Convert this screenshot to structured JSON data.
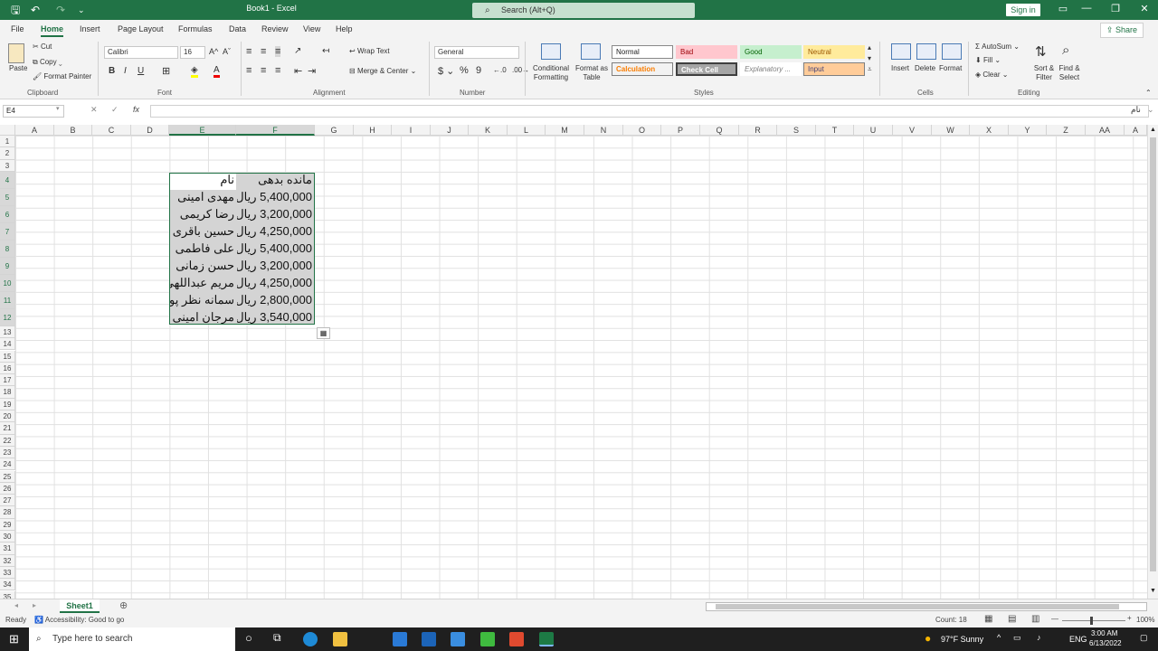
{
  "window": {
    "title": "Book1  -  Excel",
    "search": "Search (Alt+Q)",
    "signin": "Sign in"
  },
  "menu": {
    "items": [
      "File",
      "Home",
      "Insert",
      "Page Layout",
      "Formulas",
      "Data",
      "Review",
      "View",
      "Help"
    ],
    "share": "Share"
  },
  "ribbon": {
    "clipboard": {
      "paste": "Paste",
      "cut": "Cut",
      "copy": "Copy",
      "format_painter": "Format Painter",
      "label": "Clipboard"
    },
    "font": {
      "name": "Calibri",
      "size": "16",
      "label": "Font"
    },
    "alignment": {
      "wrap": "Wrap Text",
      "merge": "Merge & Center",
      "label": "Alignment"
    },
    "number": {
      "format": "General",
      "label": "Number"
    },
    "styles": {
      "conditional": "Conditional Formatting",
      "format_table": "Format as Table",
      "normal": "Normal",
      "bad": "Bad",
      "good": "Good",
      "neutral": "Neutral",
      "calculation": "Calculation",
      "check_cell": "Check Cell",
      "explanatory": "Explanatory ...",
      "input": "Input",
      "label": "Styles"
    },
    "cells": {
      "insert": "Insert",
      "delete": "Delete",
      "format": "Format",
      "label": "Cells"
    },
    "editing": {
      "autosum": "AutoSum",
      "fill": "Fill",
      "clear": "Clear",
      "sort": "Sort & Filter",
      "find": "Find & Select",
      "label": "Editing"
    }
  },
  "formula_bar": {
    "name_box": "E4",
    "fx": "fx",
    "right_label": "نام"
  },
  "columns": [
    "A",
    "B",
    "C",
    "D",
    "E",
    "F",
    "G",
    "H",
    "I",
    "J",
    "K",
    "L",
    "M",
    "N",
    "O",
    "P",
    "Q",
    "R",
    "S",
    "T",
    "U",
    "V",
    "W",
    "X",
    "Y",
    "Z",
    "AA",
    "A"
  ],
  "rows": [
    "1",
    "2",
    "3",
    "4",
    "5",
    "6",
    "7",
    "8",
    "9",
    "10",
    "11",
    "12",
    "13",
    "14",
    "15",
    "16",
    "17",
    "18",
    "19",
    "20",
    "21",
    "22",
    "23",
    "24",
    "25",
    "26",
    "27",
    "28",
    "29",
    "30",
    "31",
    "32",
    "33",
    "34",
    "35"
  ],
  "table": {
    "headers": {
      "name": "نام",
      "balance": "مانده بدهی"
    },
    "rows": [
      {
        "name": "مهدی امینی",
        "balance": "5,400,000 ریال"
      },
      {
        "name": "رضا کریمی",
        "balance": "3,200,000 ریال"
      },
      {
        "name": "حسین باقری",
        "balance": "4,250,000 ریال"
      },
      {
        "name": "علی فاطمی",
        "balance": "5,400,000 ریال"
      },
      {
        "name": "حسن زمانی",
        "balance": "3,200,000 ریال"
      },
      {
        "name": "مریم عبداللهی",
        "balance": "4,250,000 ریال"
      },
      {
        "name": "سمانه نظر پور",
        "balance": "2,800,000 ریال"
      },
      {
        "name": "مرجان امینی",
        "balance": "3,540,000 ریال"
      }
    ]
  },
  "sheet": {
    "tab": "Sheet1"
  },
  "status": {
    "ready": "Ready",
    "accessibility": "Accessibility: Good to go",
    "count": "Count: 18",
    "zoom": "100%"
  },
  "taskbar": {
    "search": "Type here to search",
    "weather": "97°F  Sunny",
    "lang": "ENG",
    "time": "3:00 AM",
    "date": "6/13/2022"
  }
}
